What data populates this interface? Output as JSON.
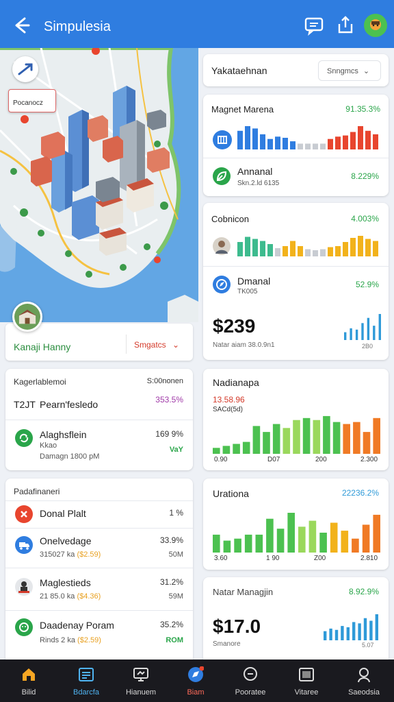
{
  "header": {
    "title": "Simpulesia"
  },
  "map": {
    "callout": "Pocanocz"
  },
  "location_card": {
    "name": "Kanaji Hanny",
    "dropdown": "Smgatcs"
  },
  "top_select": {
    "label": "Yakataehnan",
    "dropdown": "Snngmcs"
  },
  "card_magnet": {
    "title": "Magnet Marena",
    "pct": "91.35.3%",
    "row": {
      "title": "Annanal",
      "sub": "Skn.2.ld 6135",
      "pct": "8.229%"
    },
    "bars": [
      {
        "v": 0.8,
        "c": "#2f7de0"
      },
      {
        "v": 1.0,
        "c": "#2f7de0"
      },
      {
        "v": 0.9,
        "c": "#2f7de0"
      },
      {
        "v": 0.65,
        "c": "#2f7de0"
      },
      {
        "v": 0.45,
        "c": "#2f7de0"
      },
      {
        "v": 0.55,
        "c": "#2f7de0"
      },
      {
        "v": 0.5,
        "c": "#2f7de0"
      },
      {
        "v": 0.35,
        "c": "#2f7de0"
      },
      {
        "v": 0.25,
        "c": "#c8ccd2"
      },
      {
        "v": 0.25,
        "c": "#c8ccd2"
      },
      {
        "v": 0.25,
        "c": "#c8ccd2"
      },
      {
        "v": 0.25,
        "c": "#c8ccd2"
      },
      {
        "v": 0.45,
        "c": "#e8452e"
      },
      {
        "v": 0.55,
        "c": "#e8452e"
      },
      {
        "v": 0.6,
        "c": "#e8452e"
      },
      {
        "v": 0.75,
        "c": "#e8452e"
      },
      {
        "v": 1.0,
        "c": "#e8452e"
      },
      {
        "v": 0.8,
        "c": "#e8452e"
      },
      {
        "v": 0.65,
        "c": "#e8452e"
      }
    ]
  },
  "card_cobnicon": {
    "title": "Cobnicon",
    "pct": "4.003%",
    "row": {
      "title": "Dmanal",
      "sub": "TK005",
      "pct": "52.9%"
    },
    "big": "$239",
    "footnote": "Natar aiam 38.0.9n1",
    "mini_label": "2B0",
    "bars": [
      {
        "v": 0.7,
        "c": "#3dbb8e"
      },
      {
        "v": 0.95,
        "c": "#3dbb8e"
      },
      {
        "v": 0.85,
        "c": "#3dbb8e"
      },
      {
        "v": 0.75,
        "c": "#3dbb8e"
      },
      {
        "v": 0.6,
        "c": "#3dbb8e"
      },
      {
        "v": 0.4,
        "c": "#c8ccd2"
      },
      {
        "v": 0.5,
        "c": "#f2b21b"
      },
      {
        "v": 0.75,
        "c": "#f2b21b"
      },
      {
        "v": 0.5,
        "c": "#f2b21b"
      },
      {
        "v": 0.35,
        "c": "#c8ccd2"
      },
      {
        "v": 0.3,
        "c": "#c8ccd2"
      },
      {
        "v": 0.35,
        "c": "#c8ccd2"
      },
      {
        "v": 0.45,
        "c": "#f2b21b"
      },
      {
        "v": 0.5,
        "c": "#f2b21b"
      },
      {
        "v": 0.7,
        "c": "#f2b21b"
      },
      {
        "v": 0.9,
        "c": "#f2b21b"
      },
      {
        "v": 1.0,
        "c": "#f2b21b"
      },
      {
        "v": 0.85,
        "c": "#f2b21b"
      },
      {
        "v": 0.75,
        "c": "#f2b21b"
      }
    ],
    "mini_bars": [
      0.3,
      0.45,
      0.4,
      0.65,
      0.85,
      0.55,
      1.0
    ]
  },
  "stats_card": {
    "header_left": "Kagerlablemoi",
    "header_right": "S:00nonen",
    "row1": {
      "left": "T2JT",
      "title": "Pearn'fesledo",
      "pct": "353.5%"
    },
    "row2": {
      "title": "Alaghsflein",
      "sub1": "Kkao",
      "sub2": "Damagn 1800 pM",
      "pct": "169 9%",
      "badge": "VaY"
    }
  },
  "list_card": {
    "header": "Padafinaneri",
    "items": [
      {
        "title": "Donal Plalt",
        "sub": "",
        "price": "",
        "pct": "1 %",
        "right": ""
      },
      {
        "title": "Onelvedage",
        "sub": "315027 ka",
        "price": "($2.59)",
        "pct": "33.9%",
        "right": "50M"
      },
      {
        "title": "Maglestieds",
        "sub": "21 85.0 ka",
        "price": "($4.36)",
        "pct": "31.2%",
        "right": "59M"
      },
      {
        "title": "Daadenay Poram",
        "sub": "Rinds 2 ka",
        "price": "($2.59)",
        "pct": "35.2%",
        "right": "ROM"
      }
    ]
  },
  "card_nadianapa": {
    "title": "Nadianapa",
    "value": "13.58.96",
    "sub": "SACd(5d)",
    "axis": [
      "0.90",
      "D07",
      "200",
      "2.300"
    ],
    "bars": [
      {
        "v": 0.15,
        "c": "#4cc150"
      },
      {
        "v": 0.2,
        "c": "#4cc150"
      },
      {
        "v": 0.25,
        "c": "#4cc150"
      },
      {
        "v": 0.3,
        "c": "#4cc150"
      },
      {
        "v": 0.7,
        "c": "#4cc150"
      },
      {
        "v": 0.55,
        "c": "#4cc150"
      },
      {
        "v": 0.75,
        "c": "#4cc150"
      },
      {
        "v": 0.65,
        "c": "#9ad85c"
      },
      {
        "v": 0.85,
        "c": "#9ad85c"
      },
      {
        "v": 0.9,
        "c": "#4cc150"
      },
      {
        "v": 0.85,
        "c": "#9ad85c"
      },
      {
        "v": 0.95,
        "c": "#4cc150"
      },
      {
        "v": 0.8,
        "c": "#4cc150"
      },
      {
        "v": 0.75,
        "c": "#f07a25"
      },
      {
        "v": 0.8,
        "c": "#f07a25"
      },
      {
        "v": 0.55,
        "c": "#f07a25"
      },
      {
        "v": 0.9,
        "c": "#f07a25"
      }
    ]
  },
  "card_urationa": {
    "title": "Urationa",
    "pct": "22236.2%",
    "axis": [
      "3.60",
      "1 90",
      "Z00",
      "2.810"
    ],
    "bars": [
      {
        "v": 0.45,
        "c": "#4cc150"
      },
      {
        "v": 0.3,
        "c": "#4cc150"
      },
      {
        "v": 0.35,
        "c": "#4cc150"
      },
      {
        "v": 0.45,
        "c": "#4cc150"
      },
      {
        "v": 0.45,
        "c": "#4cc150"
      },
      {
        "v": 0.85,
        "c": "#4cc150"
      },
      {
        "v": 0.6,
        "c": "#4cc150"
      },
      {
        "v": 1.0,
        "c": "#4cc150"
      },
      {
        "v": 0.65,
        "c": "#9ad85c"
      },
      {
        "v": 0.8,
        "c": "#9ad85c"
      },
      {
        "v": 0.5,
        "c": "#4cc150"
      },
      {
        "v": 0.75,
        "c": "#f2b21b"
      },
      {
        "v": 0.55,
        "c": "#f2b21b"
      },
      {
        "v": 0.35,
        "c": "#f07a25"
      },
      {
        "v": 0.7,
        "c": "#f07a25"
      },
      {
        "v": 0.95,
        "c": "#f07a25"
      }
    ]
  },
  "card_manag": {
    "title": "Natar Managjin",
    "pct": "8.92.9%",
    "big": "$17.0",
    "sub": "Smanore",
    "mini_label": "5.07",
    "mini_bars": [
      0.35,
      0.45,
      0.4,
      0.55,
      0.5,
      0.7,
      0.65,
      0.85,
      0.75,
      1.0
    ]
  },
  "bottom_nav": [
    {
      "label": "Bilid",
      "icon": "home-icon"
    },
    {
      "label": "Bdarcfa",
      "icon": "dashboard-icon"
    },
    {
      "label": "Hianuem",
      "icon": "monitor-icon"
    },
    {
      "label": "Biam",
      "icon": "compass-icon"
    },
    {
      "label": "Pooratee",
      "icon": "chat-icon"
    },
    {
      "label": "Vitaree",
      "icon": "gallery-icon"
    },
    {
      "label": "Saeodsia",
      "icon": "person-icon"
    }
  ],
  "colors": {
    "header_bg": "#2f7de0",
    "accent_green": "#2aa54a",
    "accent_red": "#e8452e",
    "nav_bg": "#1a1a1f"
  }
}
